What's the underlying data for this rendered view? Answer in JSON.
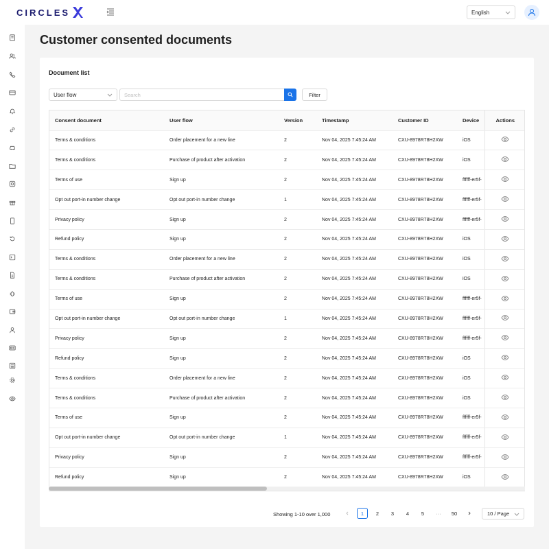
{
  "header": {
    "logo_text": "CIRCLES",
    "language": "English"
  },
  "sidebar": {
    "icons": [
      "report-icon",
      "users-icon",
      "phone-icon",
      "card-icon",
      "bell-icon",
      "link-icon",
      "car-icon",
      "folder-icon",
      "camera-icon",
      "gift-icon",
      "mobile-icon",
      "refresh-icon",
      "terminal-icon",
      "document-icon",
      "bug-icon",
      "wallet-icon",
      "person-icon",
      "id-card-icon",
      "list-icon",
      "settings-icon",
      "eye-icon"
    ]
  },
  "page": {
    "title": "Customer consented documents"
  },
  "card": {
    "title": "Document list",
    "flow_select": "User flow",
    "search_placeholder": "Search",
    "filter_label": "Filter"
  },
  "table": {
    "columns": [
      "Consent document",
      "User flow",
      "Version",
      "Timestamp",
      "Customer ID",
      "Device",
      "Actions"
    ],
    "rows": [
      [
        "Terms & conditions",
        "Order placement for a new line",
        "2",
        "Nov 04, 2025 7:45:24 AM",
        "CXU-8978R78H2XW",
        "iOS"
      ],
      [
        "Terms & conditions",
        "Purchase of product after activation",
        "2",
        "Nov 04, 2025 7:45:24 AM",
        "CXU-8978R78H2XW",
        "iOS"
      ],
      [
        "Terms of use",
        "Sign up",
        "2",
        "Nov 04, 2025 7:45:24 AM",
        "CXU-8978R78H2XW",
        "ffffff-er5f-"
      ],
      [
        "Opt out port-in number change",
        "Opt out port-in number change",
        "1",
        "Nov 04, 2025 7:45:24 AM",
        "CXU-8978R78H2XW",
        "ffffff-er5f-"
      ],
      [
        "Privacy policy",
        "Sign up",
        "2",
        "Nov 04, 2025 7:45:24 AM",
        "CXU-8978R78H2XW",
        "ffffff-er5f-"
      ],
      [
        "Refund policy",
        "Sign up",
        "2",
        "Nov 04, 2025 7:45:24 AM",
        "CXU-8978R78H2XW",
        "iOS"
      ],
      [
        "Terms & conditions",
        "Order placement for a new line",
        "2",
        "Nov 04, 2025 7:45:24 AM",
        "CXU-8978R78H2XW",
        "iOS"
      ],
      [
        "Terms & conditions",
        "Purchase of product after activation",
        "2",
        "Nov 04, 2025 7:45:24 AM",
        "CXU-8978R78H2XW",
        "iOS"
      ],
      [
        "Terms of use",
        "Sign up",
        "2",
        "Nov 04, 2025 7:45:24 AM",
        "CXU-8978R78H2XW",
        "ffffff-er5f-"
      ],
      [
        "Opt out port-in number change",
        "Opt out port-in number change",
        "1",
        "Nov 04, 2025 7:45:24 AM",
        "CXU-8978R78H2XW",
        "ffffff-er5f-"
      ],
      [
        "Privacy policy",
        "Sign up",
        "2",
        "Nov 04, 2025 7:45:24 AM",
        "CXU-8978R78H2XW",
        "ffffff-er5f-"
      ],
      [
        "Refund policy",
        "Sign up",
        "2",
        "Nov 04, 2025 7:45:24 AM",
        "CXU-8978R78H2XW",
        "iOS"
      ],
      [
        "Terms & conditions",
        "Order placement for a new line",
        "2",
        "Nov 04, 2025 7:45:24 AM",
        "CXU-8978R78H2XW",
        "iOS"
      ],
      [
        "Terms & conditions",
        "Purchase of product after activation",
        "2",
        "Nov 04, 2025 7:45:24 AM",
        "CXU-8978R78H2XW",
        "iOS"
      ],
      [
        "Terms of use",
        "Sign up",
        "2",
        "Nov 04, 2025 7:45:24 AM",
        "CXU-8978R78H2XW",
        "ffffff-er5f-"
      ],
      [
        "Opt out port-in number change",
        "Opt out port-in number change",
        "1",
        "Nov 04, 2025 7:45:24 AM",
        "CXU-8978R78H2XW",
        "ffffff-er5f-"
      ],
      [
        "Privacy policy",
        "Sign up",
        "2",
        "Nov 04, 2025 7:45:24 AM",
        "CXU-8978R78H2XW",
        "ffffff-er5f-"
      ],
      [
        "Refund policy",
        "Sign up",
        "2",
        "Nov 04, 2025 7:45:24 AM",
        "CXU-8978R78H2XW",
        "iOS"
      ]
    ]
  },
  "pagination": {
    "showing": "Showing 1-10 over 1,000",
    "pages": [
      "1",
      "2",
      "3",
      "4",
      "5",
      "50"
    ],
    "ellipsis": "···",
    "current": "1",
    "page_size": "10 / Page"
  },
  "colors": {
    "accent": "#1a73e8",
    "brand": "#1b1b6e"
  }
}
